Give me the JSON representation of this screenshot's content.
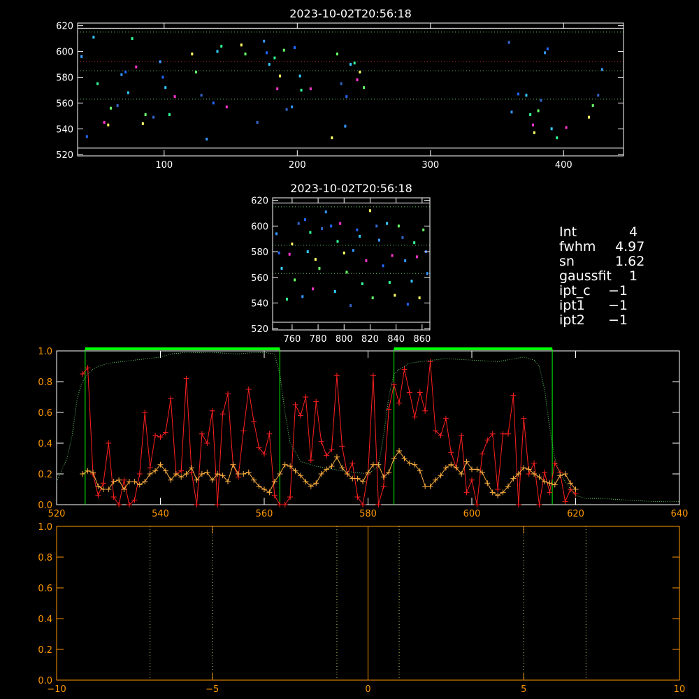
{
  "colors": {
    "background": "#000000",
    "axis_white": "#ffffff",
    "axis_orange": "#ff9900",
    "green_line": "#00ff00",
    "red_series": "#ff2020",
    "orange_series": "#ffb040",
    "dotted_green": "#66cc66",
    "dotted_red": "#cc3333",
    "dotted_yellow": "#cccc66"
  },
  "info_panel": {
    "rows": [
      {
        "key": "Int",
        "value": "4"
      },
      {
        "key": "fwhm",
        "value": "4.97"
      },
      {
        "key": "sn",
        "value": "1.62"
      },
      {
        "key": "gaussfit",
        "value": "1"
      },
      {
        "key": "ipt_c",
        "value": "−1"
      },
      {
        "key": "ipt1",
        "value": "−1"
      },
      {
        "key": "ipt2",
        "value": "−1"
      }
    ]
  },
  "chart_data": [
    {
      "type": "scatter",
      "title": "2023-10-02T20:56:18",
      "xlim": [
        35,
        445
      ],
      "ylim": [
        519,
        622
      ],
      "xticks": [
        100,
        200,
        300,
        400
      ],
      "yticks": [
        520,
        540,
        560,
        580,
        600,
        620
      ],
      "hlines_solid_white": [
        618,
        525
      ],
      "hlines_dotted_green": [
        615,
        585,
        563
      ],
      "hlines_dotted_red": [
        592
      ],
      "points": [
        [
          38,
          596
        ],
        [
          42,
          534
        ],
        [
          47,
          611
        ],
        [
          50,
          575
        ],
        [
          55,
          545
        ],
        [
          58,
          543
        ],
        [
          60,
          556
        ],
        [
          65,
          558
        ],
        [
          68,
          582
        ],
        [
          71,
          584
        ],
        [
          73,
          568
        ],
        [
          76,
          610
        ],
        [
          79,
          588
        ],
        [
          84,
          544
        ],
        [
          86,
          551
        ],
        [
          92,
          549
        ],
        [
          97,
          592
        ],
        [
          99,
          580
        ],
        [
          101,
          572
        ],
        [
          104,
          551
        ],
        [
          108,
          565
        ],
        [
          121,
          598
        ],
        [
          124,
          584
        ],
        [
          128,
          566
        ],
        [
          132,
          532
        ],
        [
          137,
          560
        ],
        [
          140,
          600
        ],
        [
          143,
          604
        ],
        [
          147,
          557
        ],
        [
          158,
          605
        ],
        [
          161,
          598
        ],
        [
          170,
          545
        ],
        [
          175,
          608
        ],
        [
          177,
          599
        ],
        [
          179,
          590
        ],
        [
          183,
          595
        ],
        [
          185,
          571
        ],
        [
          187,
          581
        ],
        [
          190,
          601
        ],
        [
          192,
          555
        ],
        [
          196,
          557
        ],
        [
          198,
          603
        ],
        [
          202,
          581
        ],
        [
          203,
          570
        ],
        [
          210,
          571
        ],
        [
          226,
          533
        ],
        [
          230,
          598
        ],
        [
          233,
          575
        ],
        [
          236,
          542
        ],
        [
          237,
          565
        ],
        [
          240,
          590
        ],
        [
          243,
          591
        ],
        [
          245,
          578
        ],
        [
          247,
          584
        ],
        [
          250,
          572
        ],
        [
          359,
          607
        ],
        [
          361,
          553
        ],
        [
          366,
          567
        ],
        [
          372,
          566
        ],
        [
          375,
          551
        ],
        [
          377,
          543
        ],
        [
          378,
          537
        ],
        [
          381,
          554
        ],
        [
          383,
          562
        ],
        [
          386,
          599
        ],
        [
          388,
          602
        ],
        [
          391,
          540
        ],
        [
          395,
          533
        ],
        [
          402,
          541
        ],
        [
          419,
          549
        ],
        [
          422,
          558
        ],
        [
          426,
          566
        ],
        [
          429,
          586
        ]
      ]
    },
    {
      "type": "scatter",
      "title": "2023-10-02T20:56:18",
      "xlim": [
        745,
        866
      ],
      "ylim": [
        519,
        622
      ],
      "xticks": [
        760,
        780,
        800,
        820,
        840,
        860
      ],
      "yticks": [
        520,
        540,
        560,
        580,
        600,
        620
      ],
      "hlines_solid_white": [
        618,
        525
      ],
      "hlines_dotted_green": [
        615,
        585,
        563
      ],
      "points": [
        [
          748,
          594
        ],
        [
          750,
          579
        ],
        [
          752,
          567
        ],
        [
          756,
          543
        ],
        [
          758,
          578
        ],
        [
          760,
          586
        ],
        [
          762,
          558
        ],
        [
          765,
          602
        ],
        [
          768,
          545
        ],
        [
          770,
          605
        ],
        [
          772,
          580
        ],
        [
          774,
          595
        ],
        [
          776,
          551
        ],
        [
          778,
          574
        ],
        [
          781,
          567
        ],
        [
          783,
          598
        ],
        [
          786,
          611
        ],
        [
          790,
          600
        ],
        [
          793,
          549
        ],
        [
          795,
          588
        ],
        [
          797,
          602
        ],
        [
          800,
          579
        ],
        [
          802,
          564
        ],
        [
          805,
          538
        ],
        [
          807,
          581
        ],
        [
          810,
          597
        ],
        [
          812,
          592
        ],
        [
          814,
          555
        ],
        [
          817,
          573
        ],
        [
          820,
          612
        ],
        [
          822,
          544
        ],
        [
          825,
          600
        ],
        [
          827,
          589
        ],
        [
          830,
          569
        ],
        [
          833,
          602
        ],
        [
          835,
          556
        ],
        [
          837,
          577
        ],
        [
          839,
          546
        ],
        [
          842,
          600
        ],
        [
          845,
          591
        ],
        [
          847,
          573
        ],
        [
          849,
          539
        ],
        [
          852,
          557
        ],
        [
          854,
          587
        ],
        [
          856,
          576
        ],
        [
          858,
          544
        ],
        [
          861,
          597
        ],
        [
          863,
          580
        ],
        [
          864,
          563
        ]
      ]
    },
    {
      "type": "line",
      "xlim": [
        520,
        640
      ],
      "ylim": [
        0,
        1.0
      ],
      "xticks": [
        520,
        540,
        560,
        580,
        600,
        620,
        640
      ],
      "yticks": [
        0.0,
        0.2,
        0.4,
        0.6,
        0.8,
        1.0
      ],
      "yticklabels": [
        "0.0",
        "0.2",
        "0.4",
        "0.6",
        "0.8",
        "1.0"
      ],
      "green_boxes": [
        [
          525.5,
          563
        ],
        [
          585,
          615.5
        ]
      ],
      "series": [
        {
          "color": "red",
          "x": [
            525,
            526,
            527,
            528,
            529,
            530,
            531,
            532,
            533,
            534,
            535,
            536,
            537,
            538,
            539,
            540,
            541,
            542,
            543,
            544,
            545,
            546,
            547,
            548,
            549,
            550,
            551,
            552,
            553,
            554,
            555,
            556,
            557,
            558,
            559,
            560,
            561,
            562,
            563,
            564,
            565,
            566,
            567,
            568,
            569,
            570,
            571,
            572,
            573,
            574,
            575,
            576,
            577,
            578,
            579,
            580,
            581,
            582,
            583,
            584,
            585,
            586,
            587,
            588,
            589,
            590,
            591,
            592,
            593,
            594,
            595,
            596,
            597,
            598,
            599,
            600,
            601,
            602,
            603,
            604,
            605,
            606,
            607,
            608,
            609,
            610,
            611,
            612,
            613,
            614,
            615,
            616,
            617,
            618,
            619,
            620
          ],
          "y": [
            0.85,
            0.89,
            0.2,
            0.06,
            0.14,
            0.4,
            0.05,
            0.0,
            0.16,
            0.0,
            0.03,
            0.2,
            0.6,
            0.24,
            0.45,
            0.44,
            0.47,
            0.69,
            0.2,
            0.22,
            0.82,
            0.21,
            0.0,
            0.46,
            0.4,
            0.61,
            0.0,
            0.59,
            0.72,
            0.26,
            0.18,
            0.48,
            0.75,
            0.54,
            0.37,
            0.33,
            0.46,
            0.06,
            0.0,
            0.0,
            0.05,
            0.65,
            0.58,
            0.7,
            0.29,
            0.67,
            0.41,
            0.32,
            0.36,
            0.84,
            0.38,
            0.2,
            0.27,
            0.05,
            0.0,
            0.2,
            0.84,
            0.0,
            0.12,
            0.62,
            0.78,
            0.66,
            0.88,
            0.73,
            0.57,
            0.73,
            0.61,
            0.93,
            0.48,
            0.45,
            0.56,
            0.34,
            0.24,
            0.45,
            0.08,
            0.16,
            0.0,
            0.33,
            0.42,
            0.46,
            0.1,
            0.46,
            0.46,
            0.71,
            0.0,
            0.56,
            0.2,
            0.27,
            0.0,
            0.21,
            0.08,
            0.27,
            0.21,
            0.02,
            0.1,
            0.07
          ]
        },
        {
          "color": "orange",
          "x": [
            525,
            526,
            527,
            528,
            529,
            530,
            531,
            532,
            533,
            534,
            535,
            536,
            537,
            538,
            539,
            540,
            541,
            542,
            543,
            544,
            545,
            546,
            547,
            548,
            549,
            550,
            551,
            552,
            553,
            554,
            555,
            556,
            557,
            558,
            559,
            560,
            561,
            562,
            563,
            564,
            565,
            566,
            567,
            568,
            569,
            570,
            571,
            572,
            573,
            574,
            575,
            576,
            577,
            578,
            579,
            580,
            581,
            582,
            583,
            584,
            585,
            586,
            587,
            588,
            589,
            590,
            591,
            592,
            593,
            594,
            595,
            596,
            597,
            598,
            599,
            600,
            601,
            602,
            603,
            604,
            605,
            606,
            607,
            608,
            609,
            610,
            611,
            612,
            613,
            614,
            615,
            616,
            617,
            618,
            619,
            620
          ],
          "y": [
            0.2,
            0.22,
            0.21,
            0.12,
            0.1,
            0.1,
            0.15,
            0.16,
            0.1,
            0.15,
            0.15,
            0.13,
            0.15,
            0.2,
            0.22,
            0.26,
            0.22,
            0.16,
            0.2,
            0.18,
            0.2,
            0.24,
            0.16,
            0.2,
            0.21,
            0.16,
            0.2,
            0.19,
            0.15,
            0.26,
            0.2,
            0.2,
            0.21,
            0.16,
            0.12,
            0.1,
            0.08,
            0.15,
            0.2,
            0.26,
            0.25,
            0.22,
            0.19,
            0.15,
            0.12,
            0.14,
            0.2,
            0.23,
            0.25,
            0.31,
            0.24,
            0.2,
            0.17,
            0.17,
            0.15,
            0.21,
            0.26,
            0.26,
            0.18,
            0.21,
            0.3,
            0.35,
            0.3,
            0.27,
            0.26,
            0.22,
            0.12,
            0.12,
            0.16,
            0.19,
            0.24,
            0.26,
            0.24,
            0.2,
            0.28,
            0.23,
            0.23,
            0.21,
            0.14,
            0.08,
            0.06,
            0.08,
            0.12,
            0.17,
            0.2,
            0.24,
            0.23,
            0.2,
            0.18,
            0.15,
            0.14,
            0.13,
            0.19,
            0.2,
            0.14,
            0.1
          ]
        },
        {
          "color": "dotted_green",
          "x": [
            520,
            522,
            523,
            524,
            525,
            526,
            527,
            528,
            530,
            535,
            540,
            542,
            545,
            550,
            555,
            558,
            560,
            562,
            563,
            564,
            565,
            567,
            570,
            575,
            580,
            582,
            583,
            584,
            585,
            586,
            587,
            588,
            590,
            595,
            600,
            605,
            610,
            612,
            613,
            614,
            615,
            616,
            617,
            618,
            619,
            620,
            622,
            625,
            630,
            635,
            640
          ],
          "y": [
            0.15,
            0.3,
            0.45,
            0.7,
            0.8,
            0.85,
            0.88,
            0.9,
            0.92,
            0.94,
            0.96,
            0.98,
            0.99,
            0.99,
            0.98,
            0.99,
            0.99,
            0.98,
            0.85,
            0.6,
            0.4,
            0.28,
            0.25,
            0.22,
            0.2,
            0.25,
            0.45,
            0.7,
            0.85,
            0.88,
            0.9,
            0.92,
            0.93,
            0.95,
            0.94,
            0.93,
            0.96,
            0.94,
            0.9,
            0.75,
            0.5,
            0.3,
            0.2,
            0.15,
            0.1,
            0.06,
            0.04,
            0.04,
            0.03,
            0.02,
            0.02
          ]
        }
      ]
    },
    {
      "type": "line",
      "xlim": [
        -10,
        10
      ],
      "ylim": [
        0,
        1.0
      ],
      "xticks": [
        -10,
        -5,
        0,
        5,
        10
      ],
      "yticks": [
        0.0,
        0.2,
        0.4,
        0.6,
        0.8,
        1.0
      ],
      "yticklabels": [
        "0.0",
        "0.2",
        "0.4",
        "0.6",
        "0.8",
        "1.0"
      ],
      "vlines_solid_orange": [
        0
      ],
      "vlines_dotted": [
        -7,
        -5,
        -1,
        1,
        5,
        7
      ]
    }
  ]
}
